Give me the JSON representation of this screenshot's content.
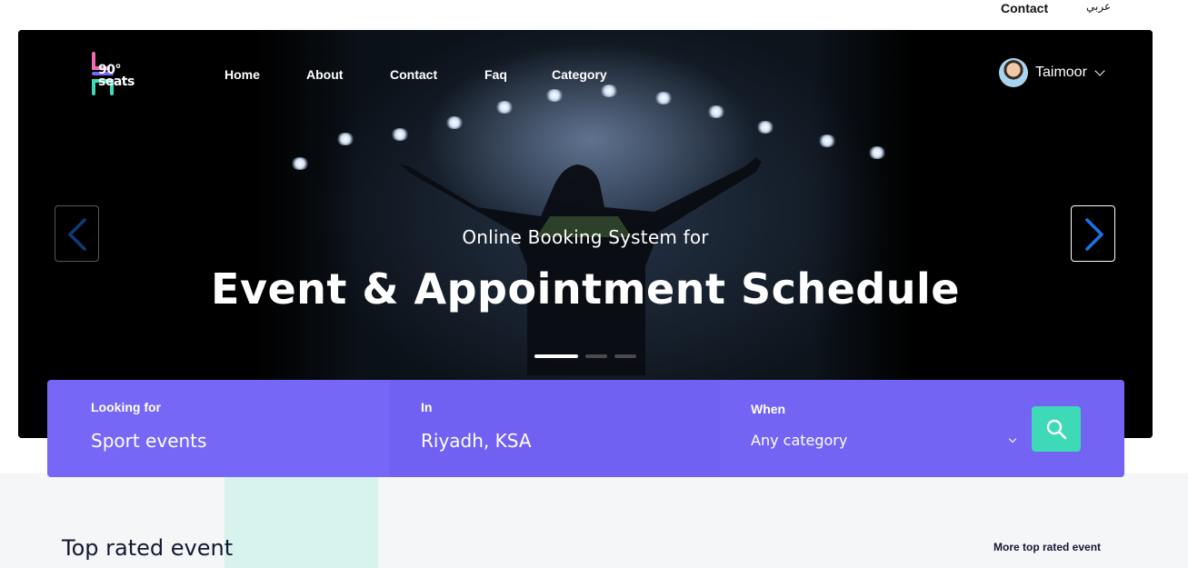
{
  "topbar": {
    "contact_label": "Contact",
    "language_label": "عربي"
  },
  "brand": {
    "logo_text_line1": "90°",
    "logo_text_line2": "seats",
    "logo_colors": [
      "#f06bb0",
      "#7767f7",
      "#3ed9b6"
    ]
  },
  "nav": {
    "items": [
      {
        "label": "Home"
      },
      {
        "label": "About"
      },
      {
        "label": "Contact"
      },
      {
        "label": "Faq"
      },
      {
        "label": "Category"
      }
    ]
  },
  "user": {
    "name": "Taimoor",
    "icon": "chevron-down-icon"
  },
  "hero": {
    "subtitle": "Online Booking System for",
    "headline": "Event & Appointment Schedule",
    "slides_count": 3,
    "active_slide": 1,
    "prev_icon": "chevron-left-icon",
    "next_icon": "chevron-right-icon",
    "arrow_color": "#1a73e8"
  },
  "search": {
    "looking_for": {
      "label": "Looking for",
      "value": "Sport events"
    },
    "location": {
      "label": "In",
      "value": "Riyadh, KSA"
    },
    "when": {
      "label": "When",
      "value": "Any category"
    },
    "button_icon": "search-icon",
    "bar_color": "#7767f7",
    "button_color": "#3ed9b6"
  },
  "top_rated": {
    "title": "Top rated event",
    "more_link": "More top rated event"
  }
}
